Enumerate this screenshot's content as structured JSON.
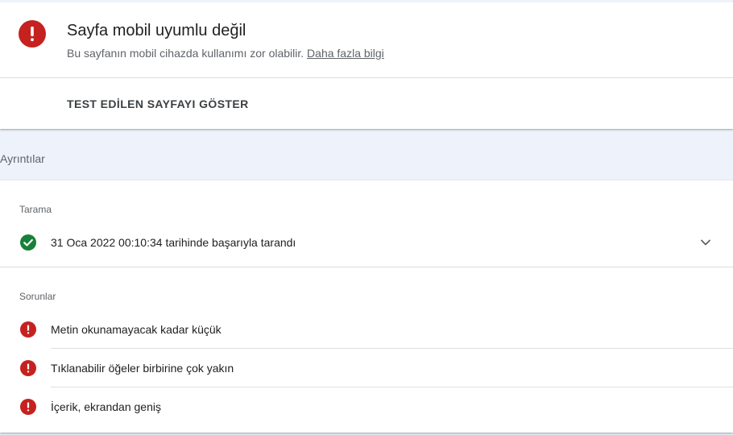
{
  "status": {
    "title": "Sayfa mobil uyumlu değil",
    "subtitle": "Bu sayfanın mobil cihazda kullanımı zor olabilir.",
    "learn_more": "Daha fazla bilgi",
    "icon": "error-icon",
    "color": "#c5221f"
  },
  "view_tested_page": "TEST EDİLEN SAYFAYI GÖSTER",
  "details": {
    "label": "Ayrıntılar"
  },
  "crawl": {
    "label": "Tarama",
    "message": "31 Oca 2022 00:10:34 tarihinde başarıyla tarandı",
    "icon": "check-circle-icon",
    "color": "#188038"
  },
  "issues": {
    "label": "Sorunlar",
    "items": [
      {
        "text": "Metin okunamayacak kadar küçük",
        "icon": "error-icon"
      },
      {
        "text": "Tıklanabilir öğeler birbirine çok yakın",
        "icon": "error-icon"
      },
      {
        "text": "İçerik, ekrandan geniş",
        "icon": "error-icon"
      }
    ]
  }
}
